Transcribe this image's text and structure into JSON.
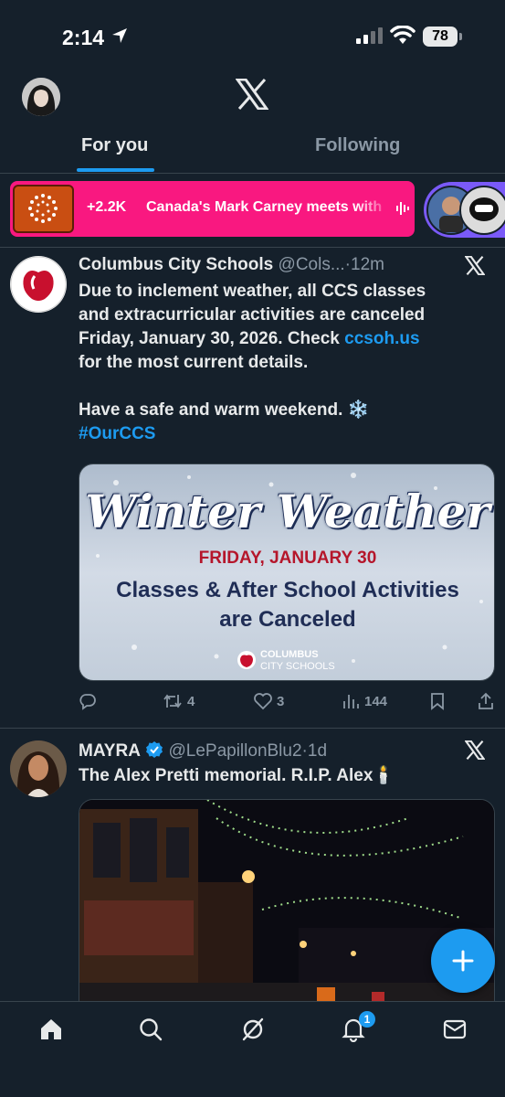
{
  "status_bar": {
    "time": "2:14",
    "battery": "78"
  },
  "tabs": [
    {
      "label": "For you",
      "active": true
    },
    {
      "label": "Following",
      "active": false
    }
  ],
  "trending": {
    "count": "+2.2K",
    "text": "Canada's Mark Carney meets with"
  },
  "posts": [
    {
      "name": "Columbus City Schools",
      "handle": "@Cols...",
      "dot": "·",
      "time": "12m",
      "text_lines": [
        "Due to inclement weather, all CCS classes",
        "and extracurricular activities are canceled",
        "Friday, January 30, 2026. Check"
      ],
      "link": "ccsoh.us",
      "text_after_link": "for the most current details.",
      "closing": "Have a safe and warm weekend. ❄️",
      "hashtag": "#OurCCS",
      "media": {
        "title": "Winter Weather",
        "date": "FRIDAY, JANUARY 30",
        "line1": "Classes & After School Activities",
        "line2": "are Canceled",
        "logo_line1": "COLUMBUS",
        "logo_line2": "CITY SCHOOLS"
      },
      "stats": {
        "replies": "",
        "reposts": "4",
        "likes": "3",
        "views": "144"
      }
    },
    {
      "name": "MAYRA",
      "handle": "@LePapillonBlu2",
      "dot": "·",
      "time": "1d",
      "text": "The Alex Pretti memorial. R.I.P. Alex🕯️"
    }
  ],
  "notifications_badge": "1",
  "colors": {
    "background": "#15202b",
    "accent": "#1d9bf0",
    "trend_pink": "#f91880",
    "divider": "#38444d"
  },
  "icons": [
    "location-arrow-icon",
    "signal-icon",
    "wifi-icon",
    "battery-icon",
    "x-logo-icon",
    "audio-bars-icon",
    "reply-icon",
    "repost-icon",
    "like-icon",
    "views-icon",
    "bookmark-icon",
    "share-icon",
    "verified-icon",
    "compose-icon",
    "home-icon",
    "search-icon",
    "grok-icon",
    "bell-icon",
    "mail-icon"
  ]
}
